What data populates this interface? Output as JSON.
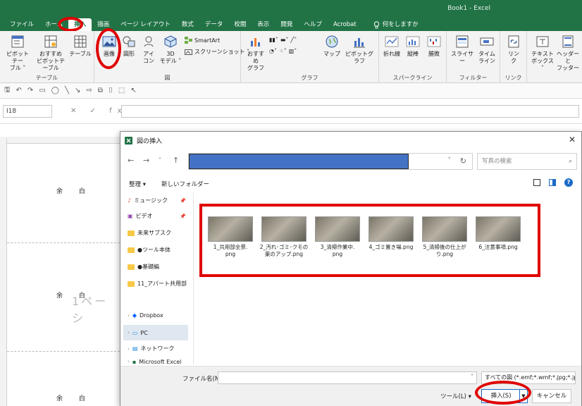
{
  "window": {
    "title": "Book1  -  Excel"
  },
  "tabs": [
    {
      "label": "ファイル"
    },
    {
      "label": "ホーム"
    },
    {
      "label": "挿入"
    },
    {
      "label": "描画"
    },
    {
      "label": "ページ レイアウト"
    },
    {
      "label": "数式"
    },
    {
      "label": "データ"
    },
    {
      "label": "校閲"
    },
    {
      "label": "表示"
    },
    {
      "label": "開発"
    },
    {
      "label": "ヘルプ"
    },
    {
      "label": "Acrobat"
    }
  ],
  "tell_me": "何をしますか",
  "ribbon": {
    "groups": {
      "table": "テーブル",
      "illustrations": "図",
      "charts": "グラフ",
      "sparklines": "スパークライン",
      "filters": "フィルター",
      "links": "リンク"
    },
    "buttons": {
      "pivot_table": "ピボットテー\nブル ˅",
      "recommended_pivot": "おすすめ\nピボットテーブル",
      "table": "テーブル",
      "image": "画像",
      "shapes": "図形",
      "icons": "アイ\nコン",
      "models_3d": "3D\nモデル ˅",
      "smartart": "SmartArt",
      "screenshot": "スクリーンショット ˅",
      "recommended_charts": "おすすめ\nグラフ",
      "maps": "マップ",
      "pivot_chart": "ピボットグラフ",
      "line": "折れ線",
      "column": "縦棒",
      "win_loss": "勝敗",
      "slicer": "スライサー",
      "timeline": "タイム\nライン",
      "link": "リン\nク",
      "textbox": "テキスト\nボックス ˅",
      "header_footer": "ヘッダーと\nフッター"
    }
  },
  "namebox": "I18",
  "formula_icons": "✕ ✓ fx",
  "sheet": {
    "margin_label": "余 白",
    "watermark": "1ペーシ"
  },
  "dialog": {
    "title": "図の挿入",
    "close": "✕",
    "search_placeholder": "写真の検索",
    "organize": "整理 ▾",
    "new_folder": "新しいフォルダー",
    "help": "?",
    "nav_items": [
      {
        "label": "ミュージック"
      },
      {
        "label": "ビデオ"
      },
      {
        "label": "未来サブスク"
      },
      {
        "label": "●ツール本体"
      },
      {
        "label": "●基礎編"
      },
      {
        "label": "11_アパート共用部"
      },
      {
        "label": "Dropbox"
      },
      {
        "label": "PC"
      },
      {
        "label": "ネットワーク"
      },
      {
        "label": "Microsoft Excel"
      }
    ],
    "files": [
      {
        "name": "1_共用部全景.\npng"
      },
      {
        "name": "2_汚れ･ゴミ･クモの\n巣のアップ.png"
      },
      {
        "name": "3_清掃作業中.\npng"
      },
      {
        "name": "4_ゴミ置き場.png"
      },
      {
        "name": "5_清掃後の仕上が\nり.png"
      },
      {
        "name": "6_注意事項.png"
      }
    ],
    "filename_label": "ファイル名(N):",
    "filename_value": "",
    "filetype": "すべての図 (*.emf;*.wmf;*.jpg;*.jp",
    "tools": "ツール(L) ▾",
    "insert": "挿入(S)",
    "cancel": "キャンセル"
  },
  "colors": {
    "accent": "#217346",
    "highlight": "#e00000",
    "address_fill": "#4472c4"
  }
}
